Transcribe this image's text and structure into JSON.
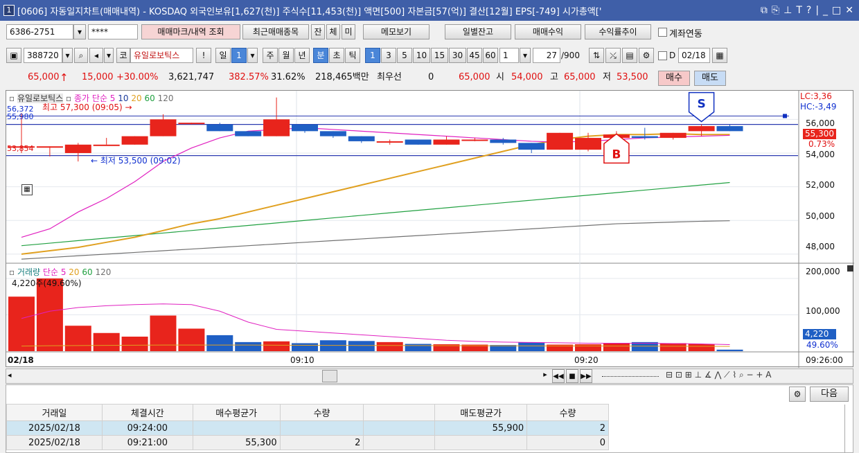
{
  "window": {
    "number": "1",
    "title": "[0606] 자동일지차트(매매내역) - KOSDAQ 외국인보유[1,627(천)] 주식수[11,453(천)] 액면[500] 자본금[57(억)] 결산[12월] EPS[-749] 시가총액['",
    "icons": [
      "restore-icon",
      "copy-window-icon",
      "pin-icon",
      "font-icon",
      "help-icon",
      "minimize-icon",
      "maximize-icon",
      "close-icon"
    ]
  },
  "toolbar1": {
    "account": "6386-2751",
    "password": "****",
    "buttons": [
      "매매마크/내역 조회",
      "최근매매종목",
      "잔",
      "체",
      "미",
      "메모보기",
      "일별잔고",
      "매매수익",
      "수익률추이"
    ],
    "checkbox_label": "계좌연동"
  },
  "toolbar2": {
    "code": "388720",
    "market": "코",
    "stock_name": "유일로보틱스",
    "exclaim": "!",
    "period_day": "일",
    "period_day_n": "1",
    "periods": [
      "주",
      "월",
      "년",
      "분",
      "초",
      "틱"
    ],
    "intervals": [
      "1",
      "3",
      "5",
      "10",
      "15",
      "30",
      "45",
      "60"
    ],
    "interval_value": "1",
    "count": "27",
    "count_max": "/900",
    "d_label": "D",
    "date": "02/18"
  },
  "quote": {
    "price": "65,000",
    "change": "15,000",
    "change_pct": "+30.00%",
    "volume": "3,621,747",
    "vol_ratio": "382.57%",
    "turnover": "31.62%",
    "amount": "218,465백만",
    "best_label": "최우선",
    "best_value": "0",
    "price2": "65,000",
    "open_label": "시",
    "open": "54,000",
    "high_label": "고",
    "high": "65,000",
    "low_label": "저",
    "low": "53,500",
    "buy": "매수",
    "sell": "매도"
  },
  "chart_text": {
    "price_legend": [
      "유일로보틱스",
      "종가 단순 5",
      "10",
      "20",
      "60",
      "120"
    ],
    "high_note": "최고 57,300 (09:05) →",
    "low_note": "← 최저 53,500 (09:02)",
    "left_labels": [
      "56,372",
      "55,980",
      "53,854"
    ],
    "lc": "LC:3,36",
    "hc": "HC:-3,49",
    "price_ticks": [
      "56,000",
      "54,000",
      "52,000",
      "50,000",
      "48,000"
    ],
    "cur_price": "55,300",
    "cur_pct": "0.73%",
    "buy_marker": "B",
    "sell_marker": "S",
    "vol_legend": [
      "거래량",
      "단순 5",
      "20",
      "60",
      "120"
    ],
    "vol_note": "4,220주(49.60%)",
    "vol_ticks": [
      "200,000",
      "100,000"
    ],
    "vol_cur": "4,220",
    "vol_pct": "49.60%",
    "time_date": "02/18",
    "time_ticks": [
      "09:10",
      "09:20"
    ],
    "time_end": "09:26:00"
  },
  "chart_data": {
    "type": "candlestick",
    "x": [
      "09:00",
      "09:01",
      "09:02",
      "09:03",
      "09:04",
      "09:05",
      "09:06",
      "09:07",
      "09:08",
      "09:09",
      "09:10",
      "09:11",
      "09:12",
      "09:13",
      "09:14",
      "09:15",
      "09:16",
      "09:17",
      "09:18",
      "09:19",
      "09:20",
      "09:21",
      "09:22",
      "09:23",
      "09:24",
      "09:25"
    ],
    "open": [
      54400,
      54400,
      54000,
      54500,
      54500,
      55000,
      55800,
      55700,
      55300,
      55000,
      55700,
      55300,
      55000,
      54700,
      54800,
      54500,
      54800,
      54800,
      54600,
      54200,
      54200,
      54900,
      55000,
      54900,
      55300,
      55600
    ],
    "close": [
      54400,
      54400,
      54500,
      54500,
      55000,
      56000,
      55800,
      55300,
      55000,
      56000,
      55300,
      55000,
      54700,
      54700,
      54500,
      54800,
      54800,
      54600,
      54200,
      55200,
      54900,
      55100,
      54900,
      55200,
      55600,
      55300
    ],
    "high": [
      56372,
      54400,
      54600,
      54900,
      55000,
      56300,
      55800,
      55800,
      55300,
      57300,
      55700,
      55300,
      55000,
      54800,
      54800,
      55000,
      54900,
      54900,
      54600,
      55200,
      55200,
      55300,
      55500,
      55200,
      55700,
      55700
    ],
    "low": [
      54000,
      53800,
      53500,
      54500,
      54500,
      55000,
      55700,
      55300,
      55000,
      55000,
      55200,
      54900,
      54600,
      54500,
      54500,
      54500,
      54700,
      54500,
      54000,
      54200,
      54100,
      54800,
      54800,
      54800,
      55000,
      55300
    ],
    "volume": [
      150000,
      200000,
      70000,
      50000,
      40000,
      98000,
      62000,
      44000,
      25000,
      27000,
      22000,
      30000,
      28000,
      25000,
      20000,
      19000,
      18000,
      17000,
      24000,
      18000,
      19000,
      22000,
      25000,
      22000,
      20000,
      4220
    ],
    "ma5": [
      49000,
      49500,
      50500,
      51300,
      52300,
      53500,
      54300,
      54900,
      55300,
      55400,
      55500,
      55400,
      55300,
      55200,
      55100,
      55000,
      54900,
      54800,
      54700,
      54650,
      54700,
      54800,
      54900,
      54950,
      55000,
      55050
    ],
    "ma20": [
      48000,
      48200,
      48400,
      48700,
      49000,
      49400,
      49800,
      50100,
      50500,
      50900,
      51300,
      51700,
      52100,
      52500,
      52900,
      53300,
      53700,
      54100,
      54500,
      54800,
      55000,
      55100,
      55100,
      55150,
      55100,
      55100
    ],
    "ma60": [
      48500,
      48650,
      48800,
      48950,
      49100,
      49250,
      49400,
      49550,
      49700,
      49850,
      50000,
      50150,
      50300,
      50450,
      50600,
      50750,
      50900,
      51050,
      51200,
      51350,
      51500,
      51650,
      51800,
      51950,
      52100,
      52250
    ],
    "ma120": [
      47700,
      47800,
      47900,
      48000,
      48100,
      48200,
      48300,
      48400,
      48500,
      48600,
      48700,
      48800,
      48900,
      49000,
      49100,
      49200,
      49300,
      49400,
      49500,
      49600,
      49700,
      49800,
      49850,
      49900,
      49950,
      49980
    ],
    "ylim": [
      47500,
      57700
    ],
    "vol_ylim": [
      0,
      240000
    ]
  },
  "table": {
    "headers": [
      "거래일",
      "체결시간",
      "매수평균가",
      "수량",
      "",
      "매도평균가",
      "수량"
    ],
    "rows": [
      [
        "2025/02/18",
        "09:24:00",
        "",
        "",
        "",
        "55,900",
        "2"
      ],
      [
        "2025/02/18",
        "09:21:00",
        "55,300",
        "2",
        "",
        "",
        "0"
      ]
    ],
    "next_button": "다음"
  },
  "colors": {
    "up": "#e8241c",
    "down": "#1f5fc4",
    "ma5": "#e020c0",
    "ma10": "#1a3a9a",
    "ma20": "#e0a020",
    "ma60": "#20a040",
    "ma120": "#707070",
    "title_bg": "#3f5fa8"
  }
}
